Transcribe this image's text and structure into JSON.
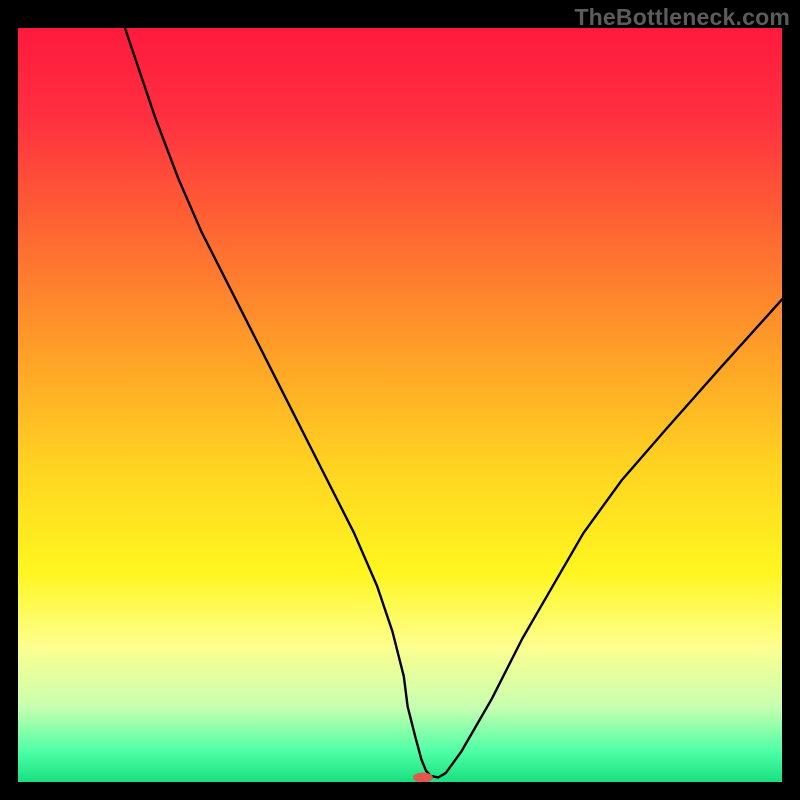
{
  "watermark": "TheBottleneck.com",
  "chart_data": {
    "type": "line",
    "title": "",
    "xlabel": "",
    "ylabel": "",
    "xlim": [
      0,
      100
    ],
    "ylim": [
      0,
      100
    ],
    "grid": false,
    "legend": false,
    "gradient_stops": [
      {
        "offset": 0.0,
        "color": "#ff1a3d"
      },
      {
        "offset": 0.12,
        "color": "#ff3040"
      },
      {
        "offset": 0.28,
        "color": "#ff6a32"
      },
      {
        "offset": 0.44,
        "color": "#ffa327"
      },
      {
        "offset": 0.58,
        "color": "#ffd321"
      },
      {
        "offset": 0.72,
        "color": "#fff61f"
      },
      {
        "offset": 0.82,
        "color": "#fdff8e"
      },
      {
        "offset": 0.9,
        "color": "#c8ffb0"
      },
      {
        "offset": 0.96,
        "color": "#4dffa6"
      },
      {
        "offset": 1.0,
        "color": "#19e07e"
      }
    ],
    "series": [
      {
        "name": "bottleneck-curve",
        "x": [
          14,
          16,
          18,
          21,
          24,
          28,
          32,
          36,
          40,
          44,
          47,
          49,
          50.5,
          51,
          52,
          52.8,
          53.4,
          54,
          55,
          56,
          58,
          62,
          66,
          70,
          74,
          79,
          85,
          92,
          100
        ],
        "y": [
          100,
          94,
          88,
          80,
          73,
          65,
          57,
          49,
          41,
          33,
          26,
          20,
          14,
          10,
          6,
          3,
          1.5,
          0.8,
          0.6,
          1.2,
          4,
          11,
          19,
          26,
          33,
          40,
          47,
          55,
          64
        ]
      }
    ],
    "marker": {
      "x": 53,
      "y": 0.6,
      "color": "#e0574f",
      "rx": 10,
      "ry": 5
    }
  }
}
